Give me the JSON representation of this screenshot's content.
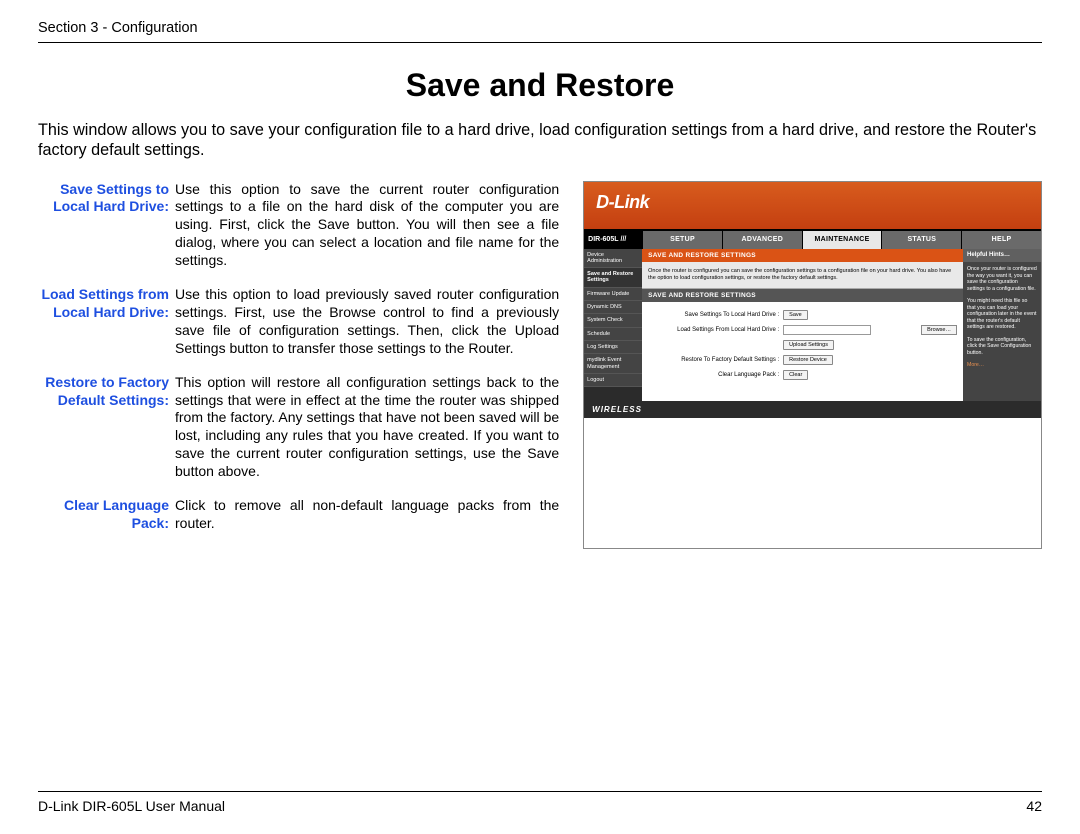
{
  "header": {
    "section": "Section 3 - Configuration"
  },
  "title": "Save and Restore",
  "intro": "This window allows you to save your configuration file to a hard drive, load configuration settings from a hard drive, and restore the Router's factory default settings.",
  "definitions": [
    {
      "label": "Save Settings to Local Hard Drive:",
      "text": "Use this option to save the current router configuration settings to a file on the hard disk of the computer you are using. First, click the Save button. You will then see a file dialog, where you can select a location and file name for the settings."
    },
    {
      "label": "Load Settings from Local Hard Drive:",
      "text": "Use this option to load previously saved router configuration settings. First, use the Browse control to find a previously save file of configuration settings. Then, click the Upload Settings button to transfer those settings to the Router."
    },
    {
      "label": "Restore to Factory Default Settings:",
      "text": "This option will restore all configuration settings back to the settings that were in effect at the time the router was shipped from the factory. Any settings that have not been saved will be lost, including any rules that you have created. If you want to save the current router configuration settings, use the Save button above."
    },
    {
      "label": "Clear Language Pack:",
      "text": "Click to remove all non-default language packs from the router."
    }
  ],
  "router": {
    "brand": "D-Link",
    "model": "DIR-605L",
    "tabs": [
      "SETUP",
      "ADVANCED",
      "MAINTENANCE",
      "STATUS",
      "HELP"
    ],
    "active_tab": "MAINTENANCE",
    "sidebar": [
      "Device Administration",
      "Save and Restore Settings",
      "Firmware Update",
      "Dynamic DNS",
      "System Check",
      "Schedule",
      "Log Settings",
      "mydlink Event Management",
      "Logout"
    ],
    "active_sidebar": "Save and Restore Settings",
    "panel_title": "SAVE AND RESTORE SETTINGS",
    "panel_desc": "Once the router is configured you can save the configuration settings to a configuration file on your hard drive. You also have the option to load configuration settings, or restore the factory default settings.",
    "panel_sub": "SAVE AND RESTORE SETTINGS",
    "form": {
      "save_label": "Save Settings To Local Hard Drive :",
      "save_btn": "Save",
      "load_label": "Load Settings From Local Hard Drive :",
      "browse_btn": "Browse…",
      "upload_btn": "Upload Settings",
      "restore_label": "Restore To Factory Default Settings :",
      "restore_btn": "Restore Device",
      "clear_label": "Clear Language Pack :",
      "clear_btn": "Clear"
    },
    "hints": {
      "title": "Helpful Hints…",
      "p1": "Once your router is configured the way you want it, you can save the configuration settings to a configuration file.",
      "p2": "You might need this file so that you can load your configuration later in the event that the router's default settings are restored.",
      "p3": "To save the configuration, click the Save Configuration button.",
      "more": "More…"
    },
    "footer": "WIRELESS"
  },
  "footer": {
    "manual": "D-Link DIR-605L User Manual",
    "page": "42"
  }
}
